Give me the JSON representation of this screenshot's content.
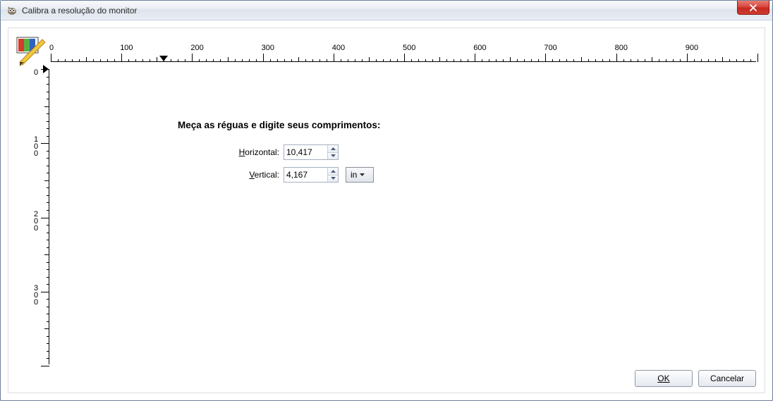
{
  "titlebar": {
    "title": "Calibra a resolução do monitor"
  },
  "hruler": {
    "labels": [
      "0",
      "100",
      "200",
      "300",
      "400",
      "500",
      "600",
      "700",
      "800",
      "900"
    ],
    "marker_at_px": 160
  },
  "vruler": {
    "labels": [
      "0",
      "100",
      "200",
      "300"
    ],
    "marker_at_px": 0
  },
  "form": {
    "heading": "Meça as réguas e digite seus comprimentos:",
    "horizontal_label_pre": "H",
    "horizontal_label_rest": "orizontal:",
    "horizontal_value": "10,417",
    "vertical_label_pre": "V",
    "vertical_label_rest": "ertical:",
    "vertical_value": "4,167",
    "unit_label": "in"
  },
  "buttons": {
    "ok": "OK",
    "cancel": "Cancelar"
  }
}
